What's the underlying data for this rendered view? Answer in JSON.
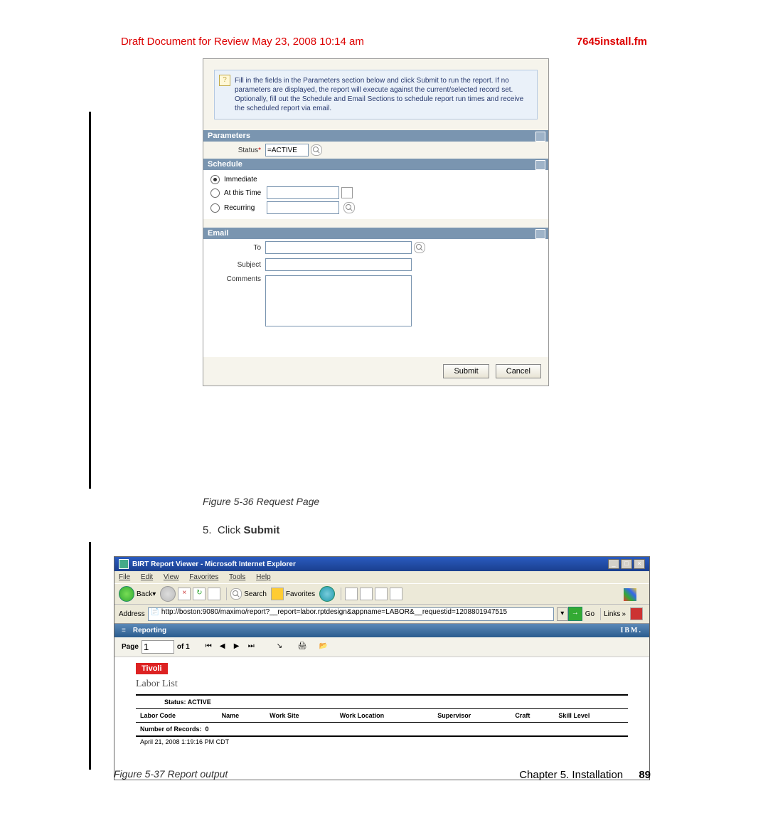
{
  "header": {
    "draft": "Draft Document for Review May 23, 2008 10:14 am",
    "filename": "7645install.fm"
  },
  "dialog": {
    "tip": "Fill in the fields in the Parameters section below and click Submit to run the report. If no parameters are displayed, the report will execute against the current/selected record set. Optionally, fill out the Schedule and Email Sections to schedule report run times and receive the scheduled report via email.",
    "sections": {
      "parameters": "Parameters",
      "schedule": "Schedule",
      "email": "Email"
    },
    "fields": {
      "status_label": "Status",
      "status_value": "=ACTIVE",
      "immediate": "Immediate",
      "atthistime": "At this Time",
      "recurring": "Recurring",
      "to": "To",
      "subject": "Subject",
      "comments": "Comments"
    },
    "buttons": {
      "submit": "Submit",
      "cancel": "Cancel"
    }
  },
  "caption1": "Figure 5-36   Request Page",
  "step": {
    "num": "5.",
    "text": "Click ",
    "bold": "Submit"
  },
  "browser": {
    "title": "BIRT Report Viewer - Microsoft Internet Explorer",
    "menu": [
      "File",
      "Edit",
      "View",
      "Favorites",
      "Tools",
      "Help"
    ],
    "back": "Back",
    "search": "Search",
    "favorites": "Favorites",
    "addr_label": "Address",
    "url": "http://boston:9080/maximo/report?__report=labor.rptdesign&appname=LABOR&__requestid=1208801947515",
    "go": "Go",
    "links": "Links",
    "banner": "Reporting",
    "ibm": "IBM.",
    "pager": {
      "page": "Page",
      "val": "1",
      "of": "of",
      "total": "1"
    }
  },
  "report": {
    "brand": "Tivoli",
    "title": "Labor List",
    "status_label": "Status:",
    "status_value": "ACTIVE",
    "cols": [
      "Labor Code",
      "Name",
      "Work Site",
      "Work Location",
      "Supervisor",
      "Craft",
      "Skill Level"
    ],
    "records_label": "Number of Records:",
    "records_value": "0",
    "timestamp": "April 21, 2008 1:19:16 PM CDT"
  },
  "caption2": "Figure 5-37   Report output",
  "footer": {
    "chapter": "Chapter 5. Installation",
    "page": "89"
  }
}
